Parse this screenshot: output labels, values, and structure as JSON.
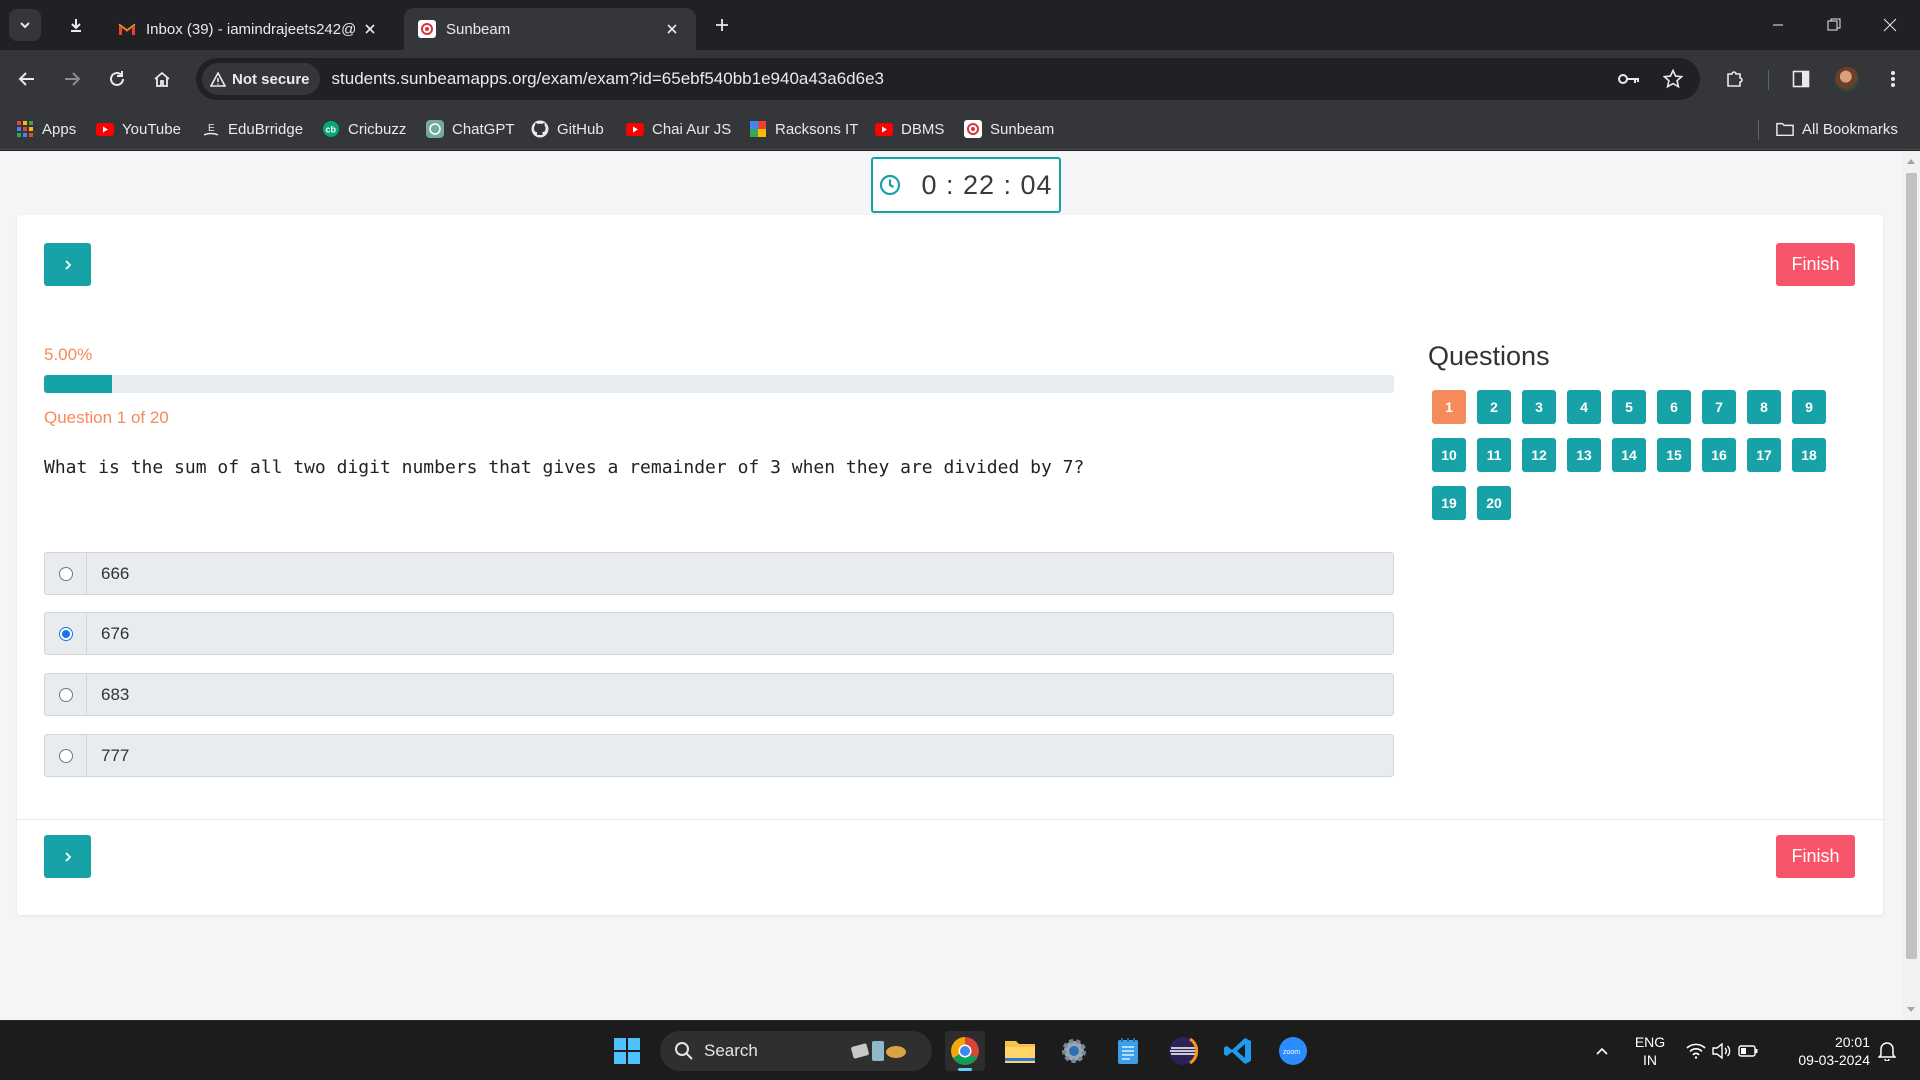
{
  "browser": {
    "tabs": [
      {
        "title": "Inbox (39) - iamindrajeets242@",
        "active": false,
        "icon": "gmail-icon"
      },
      {
        "title": "Sunbeam",
        "active": true,
        "icon": "sunbeam-icon"
      }
    ],
    "security_label": "Not secure",
    "url": "students.sunbeamapps.org/exam/exam?id=65ebf540bb1e940a43a6d6e3",
    "bookmarks": [
      {
        "label": "Apps",
        "icon": "apps-grid-icon"
      },
      {
        "label": "YouTube",
        "icon": "youtube-icon"
      },
      {
        "label": "EduBrridge",
        "icon": "edubridge-icon"
      },
      {
        "label": "Cricbuzz",
        "icon": "cricbuzz-icon"
      },
      {
        "label": "ChatGPT",
        "icon": "chatgpt-icon"
      },
      {
        "label": "GitHub",
        "icon": "github-icon"
      },
      {
        "label": "Chai Aur JS",
        "icon": "youtube-icon"
      },
      {
        "label": "Racksons IT",
        "icon": "racksons-icon"
      },
      {
        "label": "DBMS",
        "icon": "youtube-icon"
      },
      {
        "label": "Sunbeam",
        "icon": "sunbeam-icon"
      }
    ],
    "all_bookmarks_label": "All Bookmarks"
  },
  "exam": {
    "timer": "0 : 22 : 04",
    "finish_label": "Finish",
    "progress_text": "5.00%",
    "progress_value": 0.05,
    "question_counter": "Question 1 of 20",
    "question_text": "What is the sum of all two digit numbers that gives a remainder of 3 when they are divided by 7?",
    "options": [
      {
        "label": "666",
        "selected": false
      },
      {
        "label": "676",
        "selected": true
      },
      {
        "label": "683",
        "selected": false
      },
      {
        "label": "777",
        "selected": false
      }
    ],
    "questions_panel_title": "Questions",
    "question_numbers": [
      "1",
      "2",
      "3",
      "4",
      "5",
      "6",
      "7",
      "8",
      "9",
      "10",
      "11",
      "12",
      "13",
      "14",
      "15",
      "16",
      "17",
      "18",
      "19",
      "20"
    ],
    "current_question": "1"
  },
  "colors": {
    "teal": "#17a2a7",
    "orange": "#f58a5b",
    "finish_red": "#f6546a"
  },
  "taskbar": {
    "search_label": "Search",
    "language_line1": "ENG",
    "language_line2": "IN",
    "time": "20:01",
    "date": "09-03-2024"
  }
}
